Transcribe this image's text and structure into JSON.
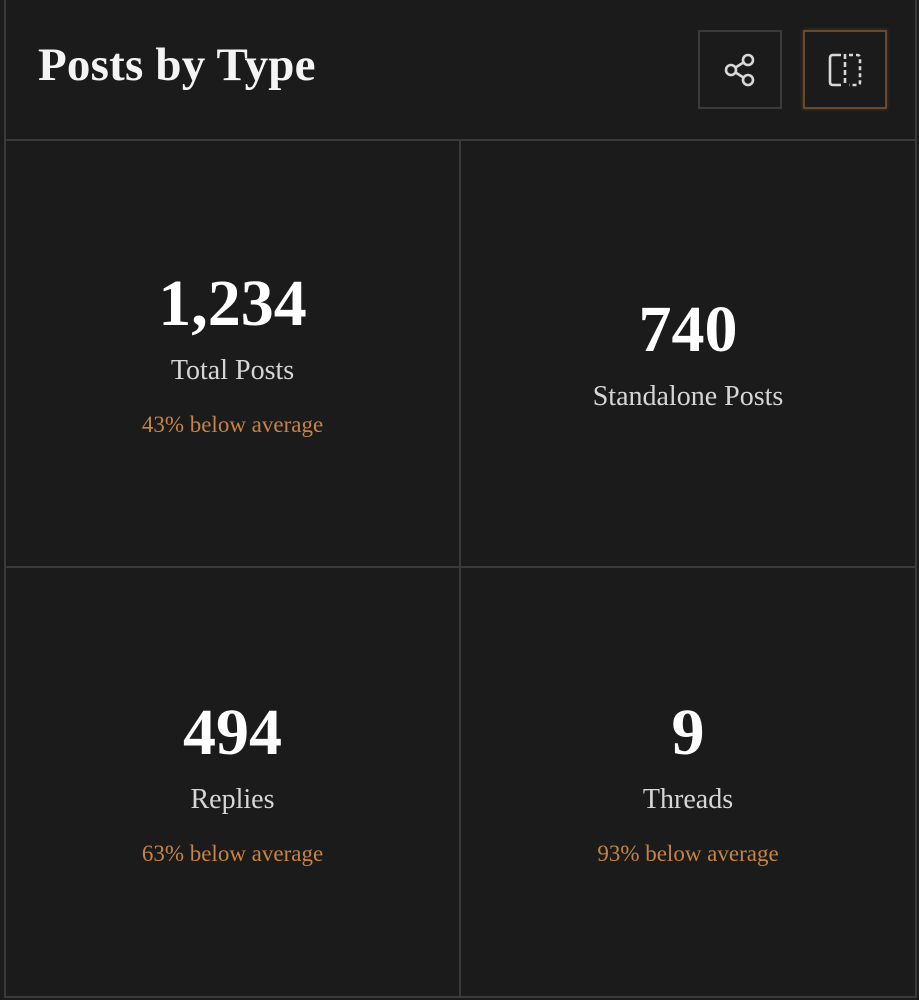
{
  "header": {
    "title": "Posts by Type",
    "share_icon": "share-icon",
    "split_icon": "split-view-icon"
  },
  "colors": {
    "background": "#1b1b1c",
    "border": "#3a3a3a",
    "accent": "#c58445",
    "text": "#ffffff"
  },
  "stats": [
    {
      "value": "1,234",
      "label": "Total Posts",
      "delta": "43% below average"
    },
    {
      "value": "740",
      "label": "Standalone Posts",
      "delta": ""
    },
    {
      "value": "494",
      "label": "Replies",
      "delta": "63% below average"
    },
    {
      "value": "9",
      "label": "Threads",
      "delta": "93% below average"
    }
  ]
}
